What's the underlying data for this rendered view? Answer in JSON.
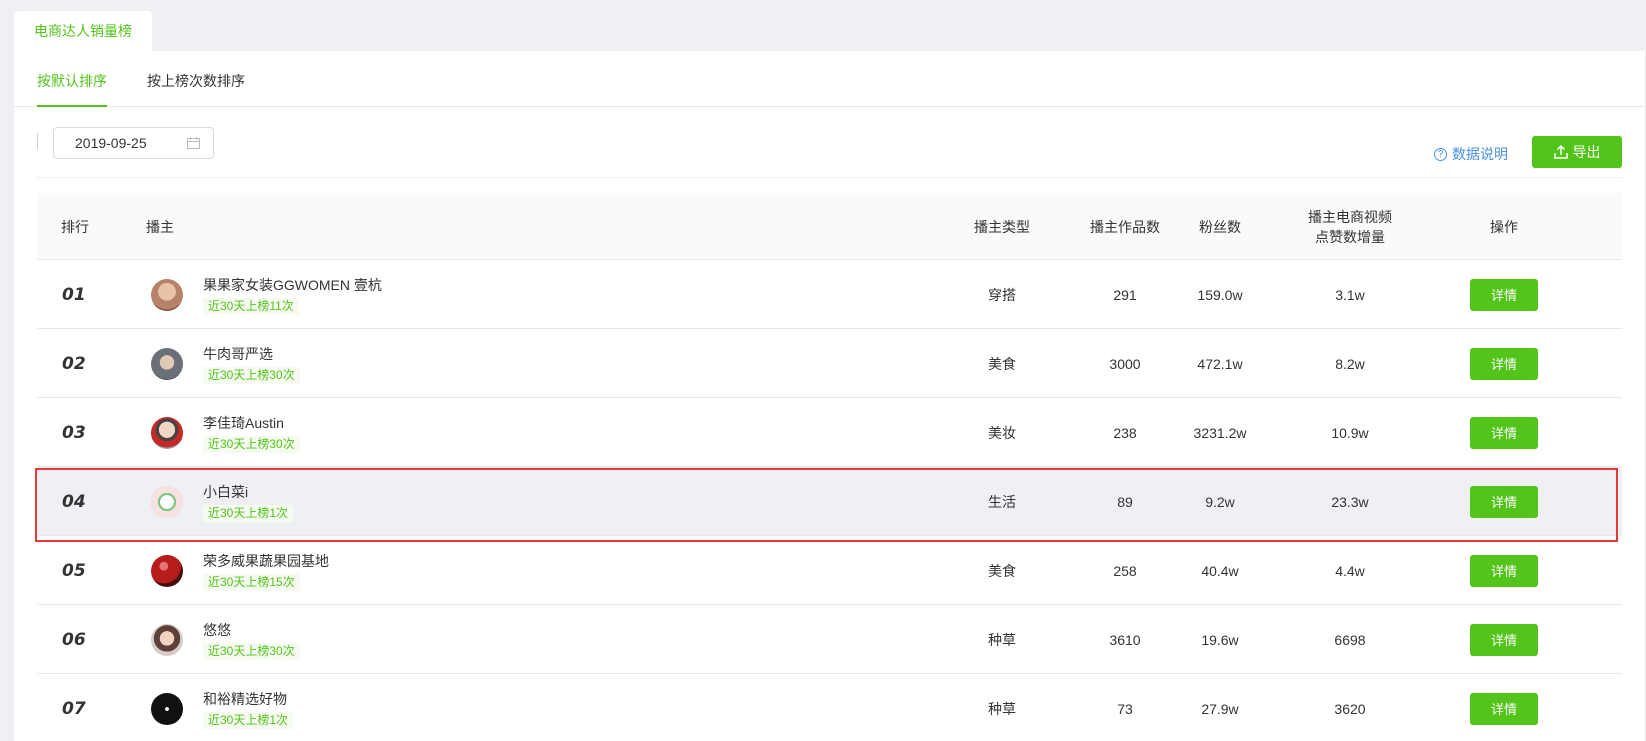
{
  "top_tab": "电商达人销量榜",
  "subtabs": [
    "按默认排序",
    "按上榜次数排序"
  ],
  "date_value": "2019-09-25",
  "help_link": "数据说明",
  "export_label": "导出",
  "columns": {
    "rank": "排行",
    "anchor": "播主",
    "type": "播主类型",
    "works": "播主作品数",
    "fans": "粉丝数",
    "likes_line1": "播主电商视频",
    "likes_line2": "点赞数增量",
    "op": "操作"
  },
  "detail_label": "详情",
  "rows": [
    {
      "rank": "01",
      "name": "果果家女装GGWOMEN 壹杭",
      "badge": "近30天上榜11次",
      "type": "穿搭",
      "works": "291",
      "fans": "159.0w",
      "likes": "3.1w",
      "avatar_color": "#b7826a"
    },
    {
      "rank": "02",
      "name": "牛肉哥严选",
      "badge": "近30天上榜30次",
      "type": "美食",
      "works": "3000",
      "fans": "472.1w",
      "likes": "8.2w",
      "avatar_color": "#6b6f78"
    },
    {
      "rank": "03",
      "name": "李佳琦Austin",
      "badge": "近30天上榜30次",
      "type": "美妆",
      "works": "238",
      "fans": "3231.2w",
      "likes": "10.9w",
      "avatar_color": "#8d6e63"
    },
    {
      "rank": "04",
      "name": "小白菜i",
      "badge": "近30天上榜1次",
      "type": "生活",
      "works": "89",
      "fans": "9.2w",
      "likes": "23.3w",
      "avatar_color": "#f3d9d9"
    },
    {
      "rank": "05",
      "name": "荣多威果蔬果园基地",
      "badge": "近30天上榜15次",
      "type": "美食",
      "works": "258",
      "fans": "40.4w",
      "likes": "4.4w",
      "avatar_color": "#8b1a1a"
    },
    {
      "rank": "06",
      "name": "悠悠",
      "badge": "近30天上榜30次",
      "type": "种草",
      "works": "3610",
      "fans": "19.6w",
      "likes": "6698",
      "avatar_color": "#a1887f"
    },
    {
      "rank": "07",
      "name": "和裕精选好物",
      "badge": "近30天上榜1次",
      "type": "种草",
      "works": "73",
      "fans": "27.9w",
      "likes": "3620",
      "avatar_color": "#111111"
    }
  ],
  "highlight_row": "04"
}
